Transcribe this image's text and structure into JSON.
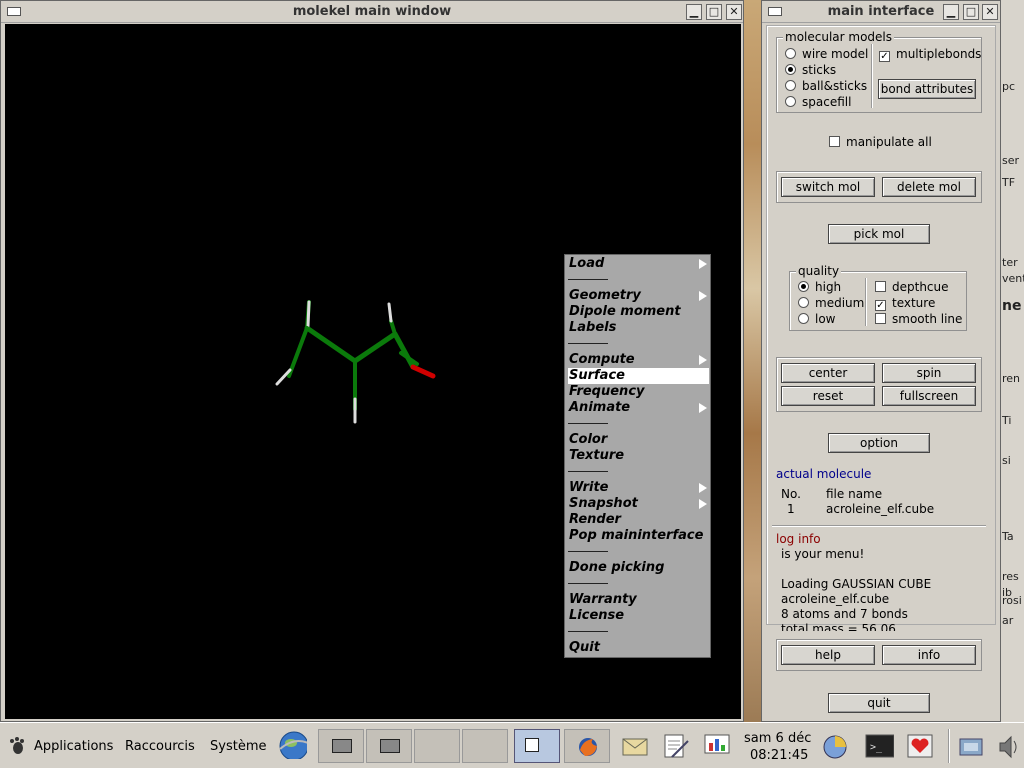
{
  "molekel_window": {
    "title": "molekel main window"
  },
  "popup_menu": {
    "items": [
      {
        "label": "Load",
        "submenu": true
      },
      {
        "label": "Geometry",
        "submenu": true
      },
      {
        "label": "Dipole moment",
        "submenu": false
      },
      {
        "label": "Labels",
        "submenu": false
      },
      {
        "label": "Compute",
        "submenu": true
      },
      {
        "label": "Surface",
        "submenu": false,
        "selected": true
      },
      {
        "label": "Frequency",
        "submenu": false
      },
      {
        "label": "Animate",
        "submenu": true
      },
      {
        "label": "Color",
        "submenu": false
      },
      {
        "label": "Texture",
        "submenu": false
      },
      {
        "label": "Write",
        "submenu": true
      },
      {
        "label": "Snapshot",
        "submenu": true
      },
      {
        "label": "Render",
        "submenu": false
      },
      {
        "label": "Pop maininterface",
        "submenu": false
      },
      {
        "label": "Done picking",
        "submenu": false
      },
      {
        "label": "Warranty",
        "submenu": false
      },
      {
        "label": "License",
        "submenu": false
      },
      {
        "label": "Quit",
        "submenu": false
      }
    ]
  },
  "main_interface": {
    "title": "main interface",
    "molecular_models": {
      "label": "molecular models",
      "options": [
        "wire model",
        "sticks",
        "ball&sticks",
        "spacefill"
      ],
      "selected": "sticks",
      "multiplebonds_label": "multiplebonds",
      "multiplebonds_checked": true,
      "bond_attributes_label": "bond attributes"
    },
    "manipulate_all_label": "manipulate all",
    "manipulate_all_checked": false,
    "switch_mol_label": "switch mol",
    "delete_mol_label": "delete mol",
    "pick_mol_label": "pick mol",
    "quality": {
      "label": "quality",
      "options": [
        "high",
        "medium",
        "low"
      ],
      "selected": "high",
      "depthcue_label": "depthcue",
      "depthcue_checked": false,
      "texture_label": "texture",
      "texture_checked": true,
      "smooth_line_label": "smooth line",
      "smooth_line_checked": false
    },
    "center_label": "center",
    "spin_label": "spin",
    "reset_label": "reset",
    "fullscreen_label": "fullscreen",
    "option_label": "option",
    "actual_molecule": {
      "title": "actual molecule",
      "col_no": "No.",
      "col_file": "file name",
      "row_no": "1",
      "row_file": "acroleine_elf.cube"
    },
    "log_info": {
      "title": "log info",
      "lines": [
        "is your menu!",
        "",
        "Loading GAUSSIAN CUBE",
        "acroleine_elf.cube",
        "8 atoms and 7 bonds",
        "total mass = 56.06"
      ]
    },
    "help_label": "help",
    "info_label": "info",
    "quit_label": "quit",
    "colors": {
      "log_title": "#8b0000",
      "molecule_title": "#00008b"
    }
  },
  "taskbar": {
    "applications": "Applications",
    "shortcuts": "Raccourcis",
    "system": "Système",
    "date": "sam  6 déc",
    "time": "08:21:45"
  },
  "background_fragments": [
    "pc",
    "ser",
    "TF",
    "ter",
    "vent",
    "ne",
    "ren",
    "Ti",
    "si",
    "Ta",
    "res",
    "ib",
    "rosi",
    "ar"
  ]
}
